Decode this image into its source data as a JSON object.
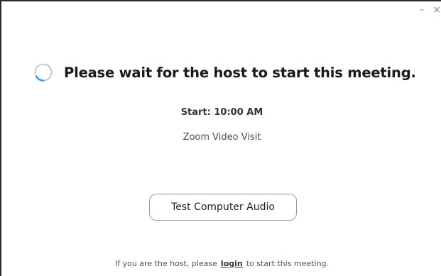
{
  "window_controls": {
    "minimize_glyph": "–",
    "close_glyph": "×"
  },
  "status": {
    "spinner_icon": "loading-spinner-icon",
    "headline": "Please wait for the host to start this meeting."
  },
  "meeting": {
    "start_time": "Start: 10:00 AM",
    "topic": "Zoom Video Visit"
  },
  "actions": {
    "test_audio_label": "Test Computer Audio"
  },
  "footer": {
    "text_before": "If you are the host, please",
    "login_link": "login",
    "text_after": "to start this meeting."
  },
  "colors": {
    "spinner_track": "#b9bcc0",
    "spinner_accent": "#2d8cff",
    "text_primary": "#1a1a1a"
  }
}
